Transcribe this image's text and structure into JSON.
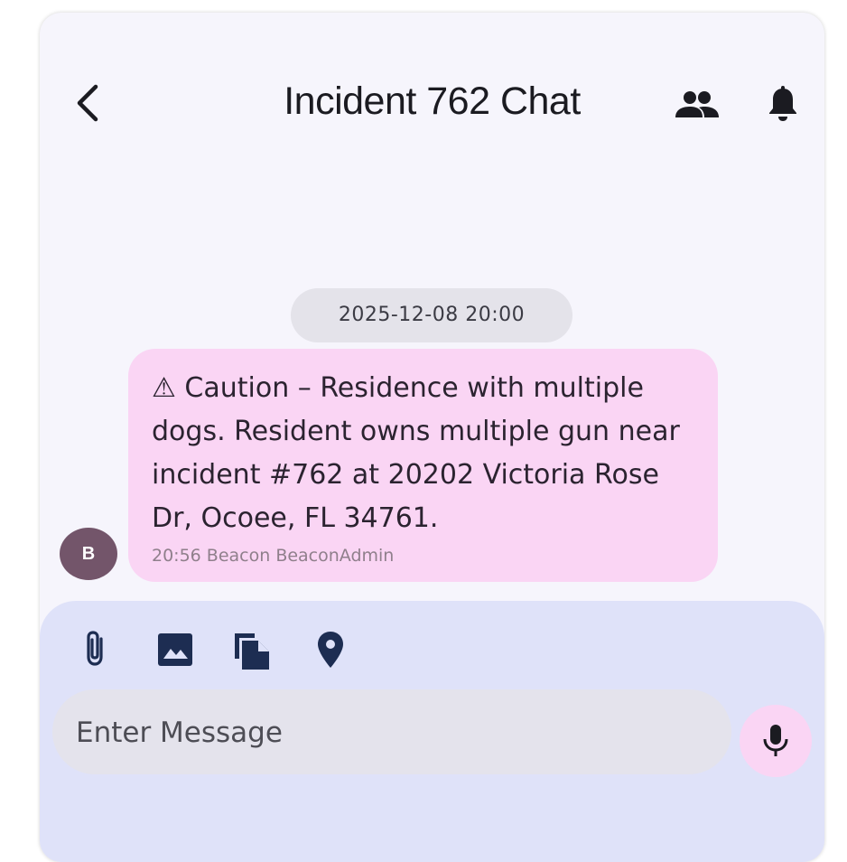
{
  "header": {
    "title": "Incident 762 Chat",
    "back_icon": "chevron-left-icon",
    "group_icon": "people-icon",
    "notify_icon": "bell-icon"
  },
  "chat": {
    "date_divider": "2025-12-08 20:00",
    "messages": [
      {
        "avatar_letter": "B",
        "text": "⚠ Caution – Residence with multiple dogs. Resident owns multiple gun near incident #762 at 20202 Victoria Rose Dr, Ocoee, FL 34761.",
        "meta": "20:56 Beacon BeaconAdmin"
      }
    ]
  },
  "composer": {
    "tools": [
      "paperclip-icon",
      "image-icon",
      "copy-document-icon",
      "location-pin-icon"
    ],
    "placeholder": "Enter Message",
    "value": "",
    "mic_icon": "microphone-icon"
  },
  "colors": {
    "background": "#f6f5fc",
    "bubble": "#fad5f4",
    "composer": "#dfe2f9",
    "icon": "#1d2d52",
    "avatar": "#73556a"
  }
}
